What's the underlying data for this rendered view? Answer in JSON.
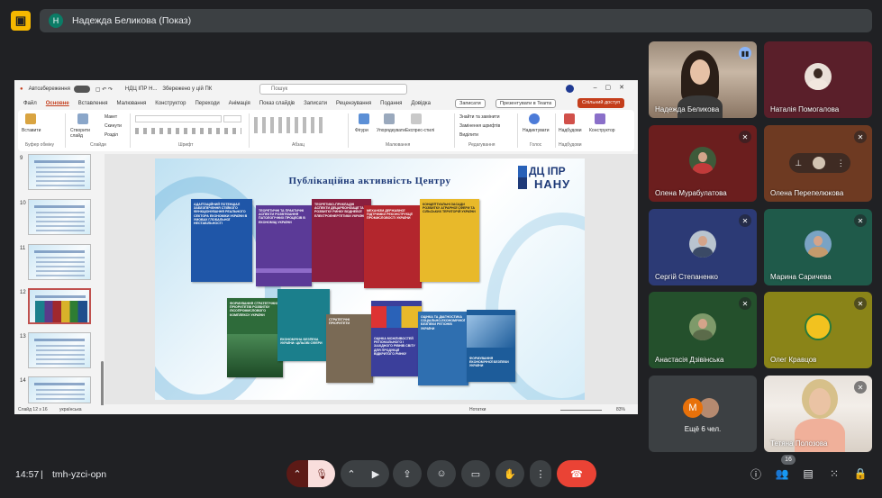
{
  "presenter": {
    "initial": "Н",
    "title": "Надежда Беликова (Показ)"
  },
  "ppt": {
    "autosave": "Автозбереження",
    "doc_name": "НДЦ ІПР Н...",
    "saved": "Збережено у цій ПК",
    "search": "Пошук",
    "user_initials": "ЕН",
    "menu": [
      "Файл",
      "Основне",
      "Вставлення",
      "Малювання",
      "Конструктор",
      "Переходи",
      "Анімація",
      "Показ слайдів",
      "Записати",
      "Рецензування",
      "Подання",
      "Довідка"
    ],
    "record_btn": "Записати",
    "teams_btn": "Презентувати в Teams",
    "share_btn": "Спільний доступ",
    "ribbon": {
      "paste": "Вставити",
      "new_slide": "Створити слайд",
      "layout": "Макет",
      "reset": "Скинути",
      "section": "Розділ",
      "shapes": "Фігури",
      "arrange": "Упорядкувати",
      "express_styles": "Експрес-стилі",
      "find_replace": "Знайти та замінити",
      "replace_fonts": "Замінення шрифтів",
      "select": "Виділити",
      "dictate": "Надиктувати",
      "addins": "Надбудови",
      "designer": "Конструктор",
      "groups": [
        "Буфер обміну",
        "Слайди",
        "Шрифт",
        "Абзац",
        "Малювання",
        "Редагування",
        "Голос",
        "Надбудови"
      ]
    },
    "thumb_numbers": [
      "9",
      "10",
      "11",
      "12",
      "13",
      "14"
    ],
    "slide": {
      "title": "Публікаційна активність Центру",
      "logo_line1": "ДЦ ІПР",
      "logo_line2": "НАНУ",
      "books_row1": [
        {
          "title": "Адаптаційний потенціал забезпечення стійкого функціонування реального сектора економіки України в умовах глобальної нестабільності",
          "color": "#1f56a8"
        },
        {
          "title": "Теоретичні та практичні аспекти розв'язання патологічних процесів в економіці України",
          "color": "#5b3a97"
        },
        {
          "title": "Теоретико-прикладні аспекти децарбонізації та розвитку ринку водневої електроенергетики України",
          "color": "#8a1f3f"
        },
        {
          "title": "Механізм державної підтримки реконструкції промисловості України",
          "color": "#b3262d"
        },
        {
          "title": "Концептуальні засади розвитку аграрної сфери та сільських територій України",
          "color": "#e8b92a"
        }
      ],
      "books_row2": [
        {
          "title": "Формування стратегічних пріоритетів розвитку лісопромислового комплексу України",
          "color": "#2e6b3a"
        },
        {
          "title": "Економічна безпека України: цільові сфери",
          "color": "#1b7f8c"
        },
        {
          "title": "Стратегічні пріоритети",
          "color": "#7a6a55"
        },
        {
          "title": "Оцінка можливостей регіонального і західного рівнів світу для продукції відкритого ринку",
          "color": "#3b3f9b"
        },
        {
          "title": "Оцінка та діагностика соціально-економічної безпеки регіонів України",
          "color": "#2f6fb0"
        },
        {
          "title": "Формування економічної безпеки України",
          "color": "#1d5c9a"
        }
      ]
    },
    "status_left": "Слайд 12 з 16",
    "status_lang": "українська",
    "status_notes": "Нотатки",
    "zoom": "83%"
  },
  "participants": [
    {
      "name": "Надежда Беликова",
      "mic": "speaking"
    },
    {
      "name": "Наталія Помогалова",
      "mic": "none"
    },
    {
      "name": "Олена Мурабулатова",
      "mic": "muted"
    },
    {
      "name": "Олена Перепелюкова",
      "mic": "muted"
    },
    {
      "name": "Сергій Степаненко",
      "mic": "muted"
    },
    {
      "name": "Марина Саричева",
      "mic": "muted"
    },
    {
      "name": "Анастасія Дзівінська",
      "mic": "muted"
    },
    {
      "name": "Олег Кравцов",
      "mic": "muted"
    },
    {
      "name": "Ещё 6 чел.",
      "initial": "М"
    },
    {
      "name": "Тетяна Полозова",
      "mic": "muted"
    }
  ],
  "bottom": {
    "time": "14:57",
    "meeting_code": "tmh-yzci-opn",
    "participant_count": "16"
  },
  "colors": {
    "meet_bg": "#202124",
    "panel": "#3c4043",
    "end_call": "#ea4335",
    "ppt_accent": "#c43e1c"
  }
}
